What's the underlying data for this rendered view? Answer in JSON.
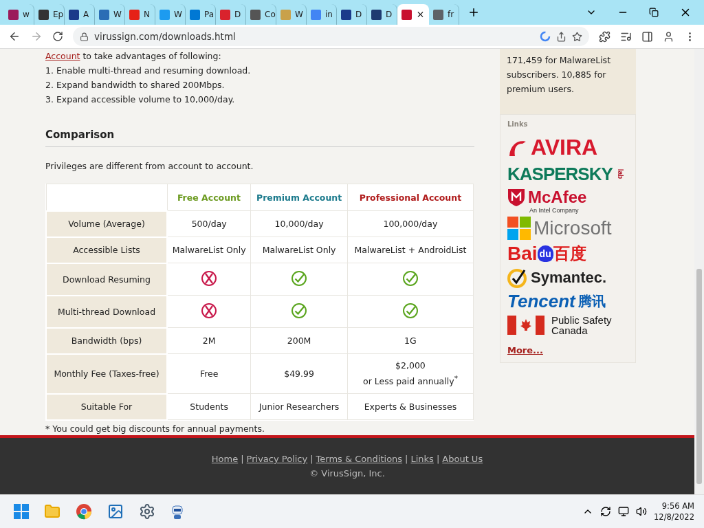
{
  "tabs": [
    {
      "label": "w",
      "selected": false
    },
    {
      "label": "Ep",
      "selected": false
    },
    {
      "label": "A",
      "selected": false
    },
    {
      "label": "W",
      "selected": false
    },
    {
      "label": "N",
      "selected": false
    },
    {
      "label": "W",
      "selected": false
    },
    {
      "label": "Pa",
      "selected": false
    },
    {
      "label": "D",
      "selected": false
    },
    {
      "label": "Co",
      "selected": false
    },
    {
      "label": "W",
      "selected": false
    },
    {
      "label": "in",
      "selected": false
    },
    {
      "label": "D",
      "selected": false
    },
    {
      "label": "D",
      "selected": false
    },
    {
      "selected": true
    },
    {
      "label": "fr",
      "selected": false
    }
  ],
  "address": "virussign.com/downloads.html",
  "intro": {
    "link": "Account",
    "text": " to take advantages of following:",
    "items": [
      "1. Enable multi-thread and resuming download.",
      "2. Expand bandwidth to shared 200Mbps.",
      "3. Expand accessible volume to 10,000/day."
    ]
  },
  "comparison": {
    "heading": "Comparison",
    "note": "Privileges are different from account to account.",
    "columns": [
      {
        "label": "Free Account",
        "color": "#6b9a1f"
      },
      {
        "label": "Premium Account",
        "color": "#1b7a8c"
      },
      {
        "label": "Professional Account",
        "color": "#b01c1c"
      }
    ],
    "rows": [
      {
        "label": "Volume (Average)",
        "cells": [
          {
            "kind": "text",
            "lines": [
              "500/day"
            ]
          },
          {
            "kind": "text",
            "lines": [
              "10,000/day"
            ]
          },
          {
            "kind": "text",
            "lines": [
              "100,000/day"
            ]
          }
        ]
      },
      {
        "label": "Accessible Lists",
        "cells": [
          {
            "kind": "text",
            "lines": [
              "MalwareList Only"
            ]
          },
          {
            "kind": "text",
            "lines": [
              "MalwareList Only"
            ]
          },
          {
            "kind": "text",
            "lines": [
              "MalwareList + AndroidList"
            ]
          }
        ]
      },
      {
        "label": "Download Resuming",
        "cells": [
          {
            "kind": "no"
          },
          {
            "kind": "yes"
          },
          {
            "kind": "yes"
          }
        ]
      },
      {
        "label": "Multi-thread Download",
        "cells": [
          {
            "kind": "no"
          },
          {
            "kind": "yes"
          },
          {
            "kind": "yes"
          }
        ]
      },
      {
        "label": "Bandwidth (bps)",
        "cells": [
          {
            "kind": "text",
            "lines": [
              "2M"
            ]
          },
          {
            "kind": "text",
            "lines": [
              "200M"
            ]
          },
          {
            "kind": "text",
            "lines": [
              "1G"
            ]
          }
        ]
      },
      {
        "label": "Monthly Fee (Taxes-free)",
        "cells": [
          {
            "kind": "text",
            "lines": [
              "Free"
            ]
          },
          {
            "kind": "text",
            "lines": [
              "$49.99"
            ]
          },
          {
            "kind": "text",
            "lines": [
              "$2,000",
              "or Less paid annually$^{*}$"
            ]
          }
        ]
      },
      {
        "label": "Suitable For",
        "cells": [
          {
            "kind": "text",
            "lines": [
              "Students"
            ]
          },
          {
            "kind": "text",
            "lines": [
              "Junior Researchers"
            ]
          },
          {
            "kind": "text",
            "lines": [
              "Experts & Businesses"
            ]
          }
        ]
      }
    ],
    "footnote": "* You could get big discounts for annual payments."
  },
  "sidebar": {
    "stats": "171,459 for MalwareList subscribers. 10,885 for premium users.",
    "links_heading": "Links",
    "logos": [
      {
        "kind": "avira",
        "text": "AVIRA"
      },
      {
        "kind": "kaspersky",
        "text": "KASPERSKY",
        "sub": "lab"
      },
      {
        "kind": "mcafee",
        "text": "McAfee",
        "sub": "An Intel Company"
      },
      {
        "kind": "microsoft",
        "text": "Microsoft"
      },
      {
        "kind": "baidu",
        "text": "Bai",
        "mid": "du",
        "sub": "百度"
      },
      {
        "kind": "symantec",
        "text": "Symantec."
      },
      {
        "kind": "tencent",
        "text": "Tencent",
        "sub": "腾讯"
      },
      {
        "kind": "canada",
        "text": "Public Safety",
        "sub": "Canada"
      }
    ],
    "more": "More..."
  },
  "footer": {
    "links": [
      "Home",
      "Privacy Policy",
      "Terms & Conditions",
      "Links",
      "About Us"
    ],
    "separator": "|",
    "copyright": "© VirusSign, Inc."
  },
  "taskbar": {
    "time": "9:56 AM",
    "date": "12/8/2022"
  }
}
